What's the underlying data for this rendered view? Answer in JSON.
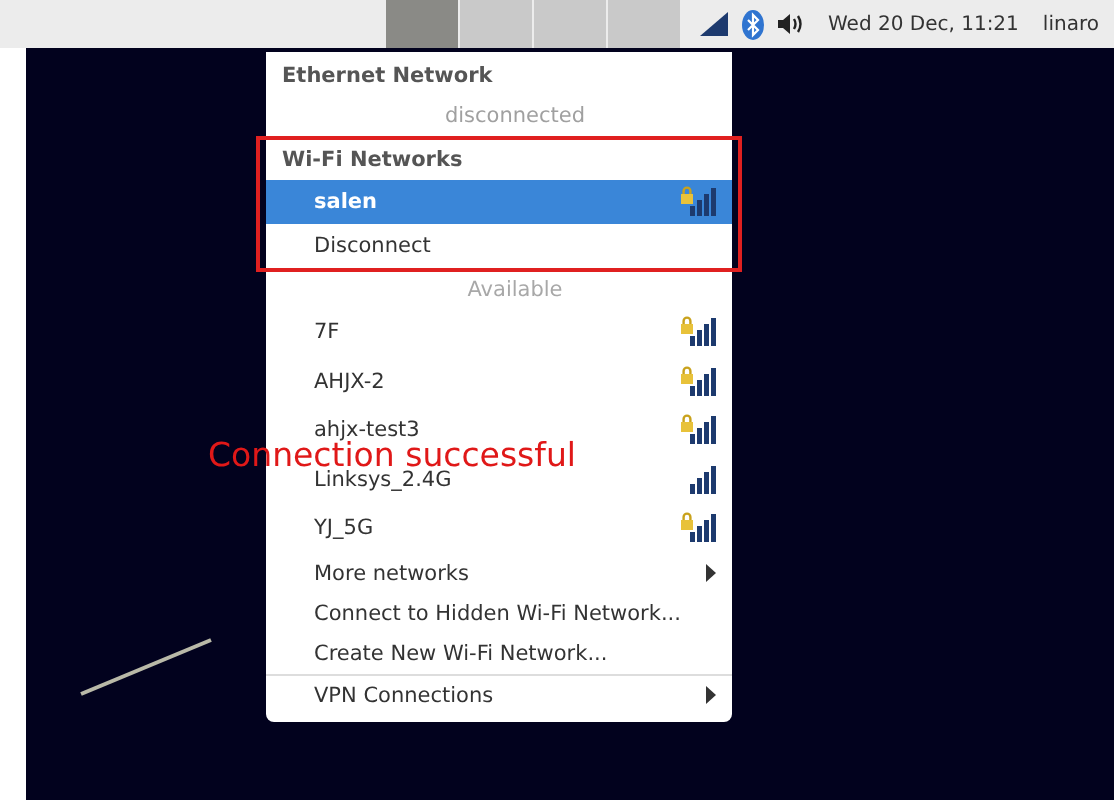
{
  "panel": {
    "taskbar_buttons": [
      {
        "selected": true
      },
      {
        "selected": false
      },
      {
        "selected": false
      },
      {
        "selected": false
      }
    ],
    "clock": "Wed 20 Dec, 11:21",
    "user": "linaro"
  },
  "menu": {
    "ethernet": {
      "header": "Ethernet Network",
      "status": "disconnected"
    },
    "wifi": {
      "header": "Wi-Fi Networks",
      "connected": {
        "name": "salen",
        "selected": true,
        "secure": true
      },
      "disconnect": "Disconnect"
    },
    "available_label": "Available",
    "networks": [
      {
        "name": "7F",
        "secure": true
      },
      {
        "name": "AHJX-2",
        "secure": true
      },
      {
        "name": "ahjx-test3",
        "secure": true
      },
      {
        "name": "Linksys_2.4G",
        "secure": false
      },
      {
        "name": "YJ_5G",
        "secure": true
      }
    ],
    "actions": [
      {
        "label": "More networks",
        "submenu": true
      },
      {
        "label": "Connect to Hidden Wi-Fi Network...",
        "submenu": false
      },
      {
        "label": "Create New Wi-Fi Network...",
        "submenu": false
      }
    ],
    "vpn": {
      "label": "VPN Connections",
      "submenu": true
    }
  },
  "annotation": "Connection successful"
}
